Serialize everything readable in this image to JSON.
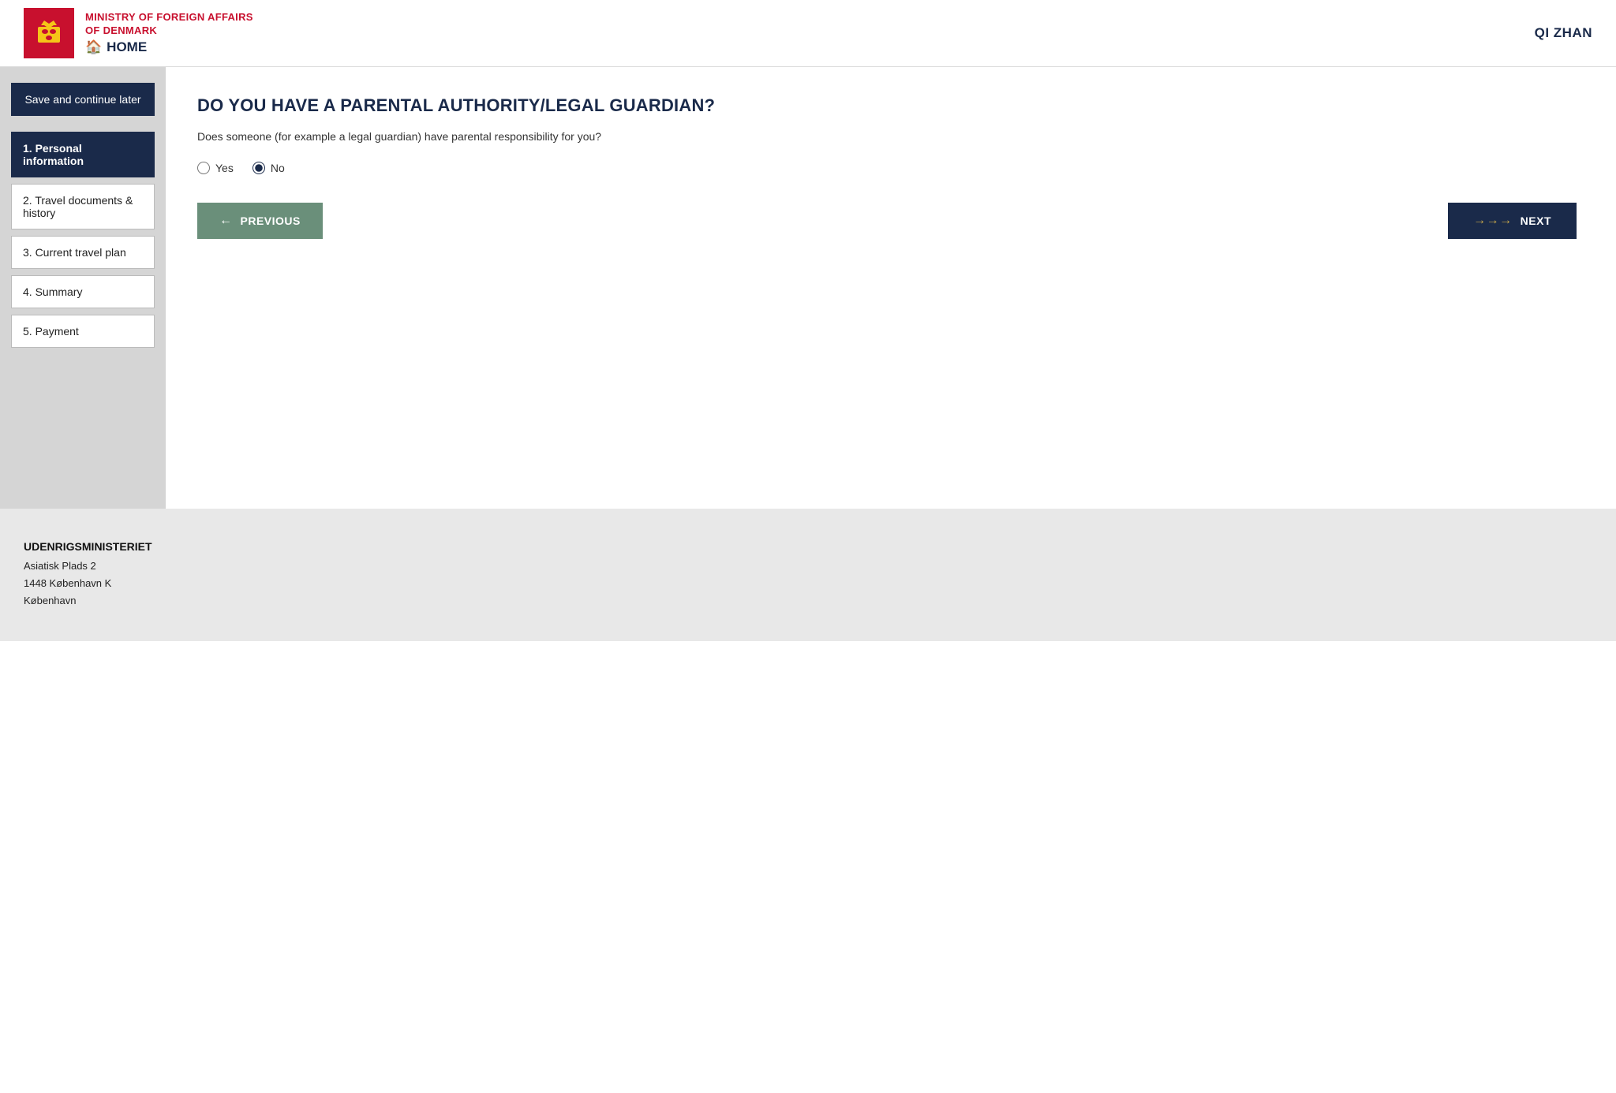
{
  "header": {
    "org_name_line1": "MINISTRY OF FOREIGN AFFAIRS",
    "org_name_line2": "OF DENMARK",
    "home_label": "HOME",
    "user_name": "QI ZHAN"
  },
  "sidebar": {
    "save_button_label": "Save and continue later",
    "nav_items": [
      {
        "id": "personal",
        "label": "1. Personal information",
        "active": true
      },
      {
        "id": "travel",
        "label": "2. Travel documents & history",
        "active": false
      },
      {
        "id": "current",
        "label": "3. Current travel plan",
        "active": false
      },
      {
        "id": "summary",
        "label": "4. Summary",
        "active": false
      },
      {
        "id": "payment",
        "label": "5. Payment",
        "active": false
      }
    ]
  },
  "content": {
    "question_title": "DO YOU HAVE A PARENTAL AUTHORITY/LEGAL GUARDIAN?",
    "question_desc": "Does someone (for example a legal guardian) have parental responsibility for you?",
    "radio_yes_label": "Yes",
    "radio_no_label": "No",
    "radio_selected": "no",
    "btn_previous_label": "PREVIOUS",
    "btn_next_label": "NEXT"
  },
  "footer": {
    "org_name": "UDENRIGSMINISTERIET",
    "address_line1": "Asiatisk Plads 2",
    "address_line2": "1448 København K",
    "address_line3": "København"
  }
}
